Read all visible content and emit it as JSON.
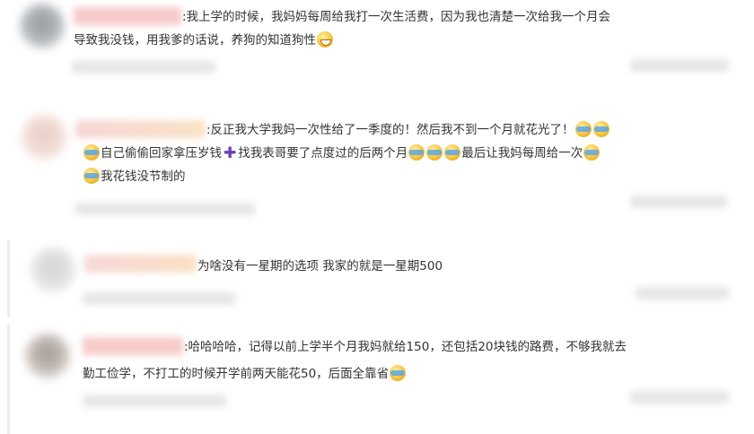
{
  "comments": [
    {
      "text1": ":我上学的时候，我妈妈每周给我打一次生活费，因为我也清楚一次给我一个月会",
      "text2": "导致我没钱，用我爹的话说，养狗的知道狗性",
      "emoji_end": "grin-face-icon"
    },
    {
      "text1": ":反正我大学我妈一次性给了一季度的！然后我不到一个月就花光了！",
      "text2a": "自己偷偷回家拿压岁钱",
      "text2b": "找我表哥要了点度过的后两个月",
      "text2c": "最后让我妈每周给一次",
      "text3": "我花钱没节制的",
      "emoji": "crying-laughing-face-icon"
    },
    {
      "text1": "为啥没有一星期的选项 我家的就是一星期500"
    },
    {
      "text1": ":哈哈哈哈，记得以前上学半个月我妈就给150，还包括20块钱的路费，不够我就去",
      "text2": "勤工俭学，不打工的时候开学前两天能花50，后面全靠省",
      "emoji": "crying-laughing-face-icon"
    }
  ]
}
